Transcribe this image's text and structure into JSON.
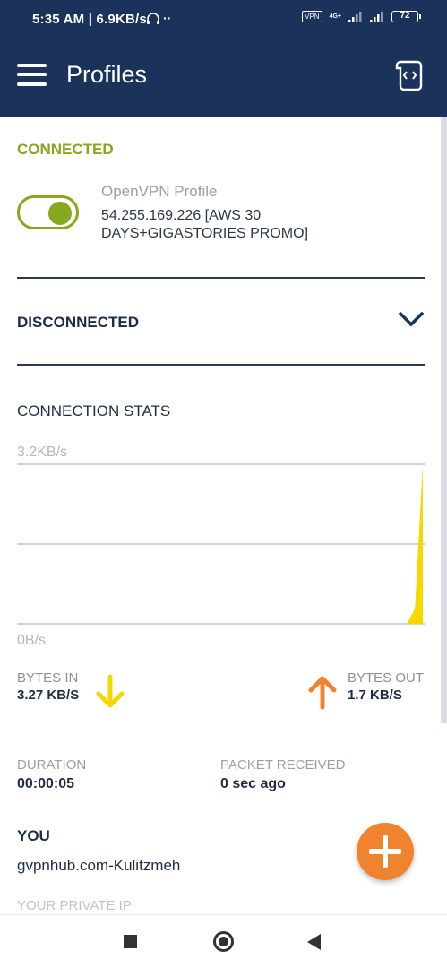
{
  "status_bar": {
    "time": "5:35 AM | 6.9KB/s",
    "vpn_badge": "VPN",
    "network": "4G+",
    "battery": "72"
  },
  "app_bar": {
    "title": "Profiles"
  },
  "connected_section": {
    "label": "CONNECTED",
    "toggle_on": true,
    "profile_type": "OpenVPN Profile",
    "profile_server": "54.255.169.226 [AWS 30 DAYS+GIGASTORIES PROMO]"
  },
  "disconnected_section": {
    "label": "DISCONNECTED"
  },
  "stats": {
    "title": "CONNECTION STATS",
    "axis_max": "3.2KB/s",
    "axis_min": "0B/s",
    "bytes_in_label": "BYTES IN",
    "bytes_in_value": "3.27 KB/S",
    "bytes_out_label": "BYTES OUT",
    "bytes_out_value": "1.7 KB/S"
  },
  "chart_data": {
    "type": "area",
    "title": "",
    "xlabel": "",
    "ylabel": "",
    "ylim": [
      0,
      3.2
    ],
    "y_tick_labels": [
      "0B/s",
      "3.2KB/s"
    ],
    "grid": true,
    "series": [
      {
        "values": [
          0,
          0,
          0,
          0,
          0,
          0,
          0,
          0,
          0,
          0,
          0,
          0,
          0,
          0,
          0,
          0,
          0,
          0,
          0,
          0,
          0,
          0,
          0,
          0,
          0,
          0,
          0,
          0,
          0,
          0,
          0,
          0,
          0,
          0,
          0,
          0,
          0,
          0,
          0,
          0,
          0,
          0,
          0,
          0,
          0,
          0,
          0,
          0,
          0,
          0,
          0.3,
          3.2
        ],
        "color": "#f5d800"
      }
    ]
  },
  "details": {
    "duration_label": "DURATION",
    "duration_value": "00:00:05",
    "packet_label": "PACKET RECEIVED",
    "packet_value": "0 sec ago"
  },
  "you": {
    "label": "YOU",
    "value": "gvpnhub.com-Kulitzmeh",
    "private_ip_label": "YOUR PRIVATE IP"
  },
  "colors": {
    "header": "#1b325a",
    "connected": "#86a81c",
    "accent": "#f0842e",
    "bytes_in_arrow": "#f5d800"
  }
}
